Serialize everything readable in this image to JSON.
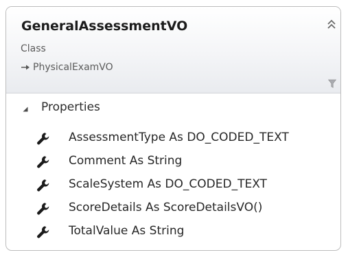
{
  "class": {
    "name": "GeneralAssessmentVO",
    "stereotype": "Class",
    "base_class": "PhysicalExamVO"
  },
  "icons": {
    "collapse": "double-chevron-up-icon",
    "filter": "filter-icon",
    "inheritance": "inheritance-arrow-icon",
    "expand": "expand-triangle-icon",
    "property": "wrench-icon"
  },
  "sections": [
    {
      "label": "Properties",
      "items": [
        {
          "label": "AssessmentType As DO_CODED_TEXT"
        },
        {
          "label": "Comment As String"
        },
        {
          "label": "ScaleSystem As DO_CODED_TEXT"
        },
        {
          "label": "ScoreDetails As ScoreDetailsVO()"
        },
        {
          "label": "TotalValue As String"
        }
      ]
    }
  ],
  "colors": {
    "border": "#bcbcbc",
    "header_gradient_end": "#e9ebef",
    "icon_dark": "#1b1b1b",
    "icon_gray": "#8a8a8a"
  }
}
